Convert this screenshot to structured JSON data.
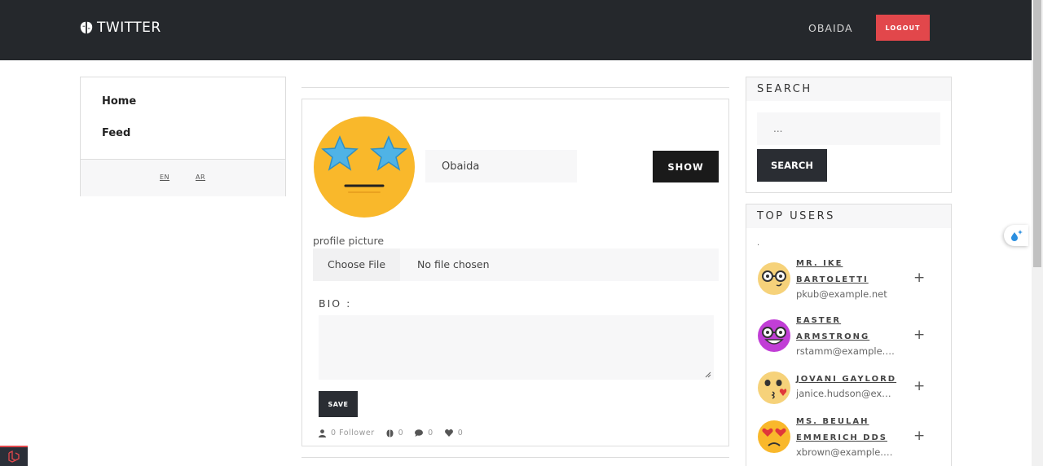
{
  "navbar": {
    "brand": "TWITTER",
    "user_name": "OBAIDA",
    "logout_label": "LOGOUT"
  },
  "sidebar": {
    "items": [
      {
        "label": "Home"
      },
      {
        "label": "Feed"
      }
    ],
    "languages": [
      "EN",
      "AR"
    ]
  },
  "profile": {
    "name_value": "Obaida",
    "show_label": "SHOW",
    "picture_label": "profile picture",
    "choose_file_label": "Choose File",
    "no_file_label": "No file chosen",
    "bio_label": "BIO :",
    "save_label": "SAVE",
    "stats": {
      "followers": "0 Follower",
      "tweets": "0",
      "comments": "0",
      "likes": "0"
    }
  },
  "search": {
    "title": "SEARCH",
    "placeholder": "...",
    "button_label": "SEARCH"
  },
  "top_users": {
    "title": "TOP USERS",
    "dot": ".",
    "users": [
      {
        "name": "MR. IKE BARTOLETTI",
        "email": "pkub@example.net"
      },
      {
        "name": "EASTER ARMSTRONG",
        "email": "rstamm@example.net"
      },
      {
        "name": "JOVANI GAYLORD",
        "email": "janice.hudson@example.com"
      },
      {
        "name": "MS. BEULAH EMMERICH DDS",
        "email": "xbrown@example.com"
      }
    ]
  },
  "colors": {
    "navbar_bg": "#25282c",
    "logout_bg": "#e2474b",
    "show_bg": "#1a1a1a",
    "button_dark": "#2a2d33"
  }
}
